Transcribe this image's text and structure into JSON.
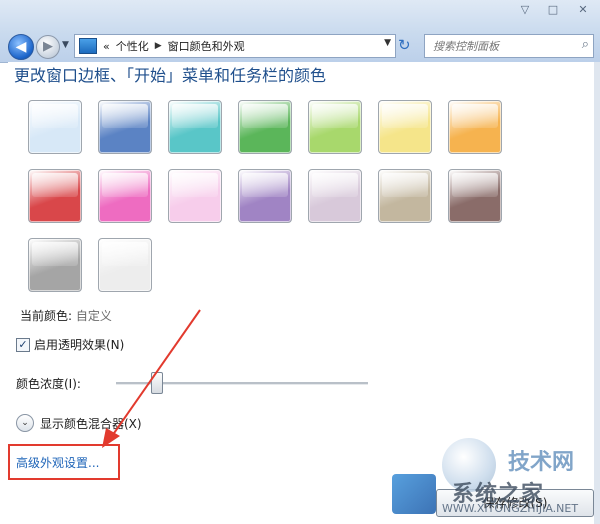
{
  "window": {
    "min_glyph": "▽",
    "max_glyph": "□",
    "close_glyph": "✕"
  },
  "nav": {
    "back_glyph": "◀",
    "forward_glyph": "▶",
    "history_glyph": "▼",
    "chevrons": "«",
    "crumb1": "个性化",
    "crumb2": "窗口颜色和外观",
    "sep_glyph": "▶",
    "dropdown_glyph": "▼",
    "refresh_glyph": "↻",
    "search_placeholder": "搜索控制面板",
    "search_glyph": "⌕"
  },
  "page": {
    "heading": "更改窗口边框、「开始」菜单和任务栏的颜色",
    "swatches": [
      {
        "name": "sky",
        "color": "#d7e8f7"
      },
      {
        "name": "twilight",
        "color": "#5b83c4"
      },
      {
        "name": "sea",
        "color": "#59c6c8"
      },
      {
        "name": "leaf",
        "color": "#5bb65a"
      },
      {
        "name": "lime",
        "color": "#a8d86c"
      },
      {
        "name": "lemon",
        "color": "#f5e58a"
      },
      {
        "name": "tangerine",
        "color": "#f6b34f"
      },
      {
        "name": "ruby",
        "color": "#d9474a"
      },
      {
        "name": "fuchsia",
        "color": "#ee6cc1"
      },
      {
        "name": "blush",
        "color": "#f7cdeb"
      },
      {
        "name": "violet",
        "color": "#a084c4"
      },
      {
        "name": "lavender",
        "color": "#d8c9da"
      },
      {
        "name": "taupe",
        "color": "#c3b79f"
      },
      {
        "name": "chocolate",
        "color": "#8a6c69"
      },
      {
        "name": "slate",
        "color": "#a5a5a5"
      },
      {
        "name": "frost",
        "color": "#ededed"
      }
    ],
    "current_label": "当前颜色:",
    "current_value": "自定义",
    "transparency_glyph": "✓",
    "transparency_label": "启用透明效果(N)",
    "intensity_label": "颜色浓度(I):",
    "intensity_value": 0.16,
    "mixer_glyph": "⌄",
    "mixer_label": "显示颜色混合器(X)",
    "advanced_link": "高级外观设置...",
    "save_button": "保存修改(S)"
  },
  "annotation": {
    "color": "#e23a2e"
  },
  "watermark": {
    "site_main": "系统之家",
    "site_alt": "技术网",
    "site_url": "WWW.XITONGZHIJIA.NET"
  }
}
